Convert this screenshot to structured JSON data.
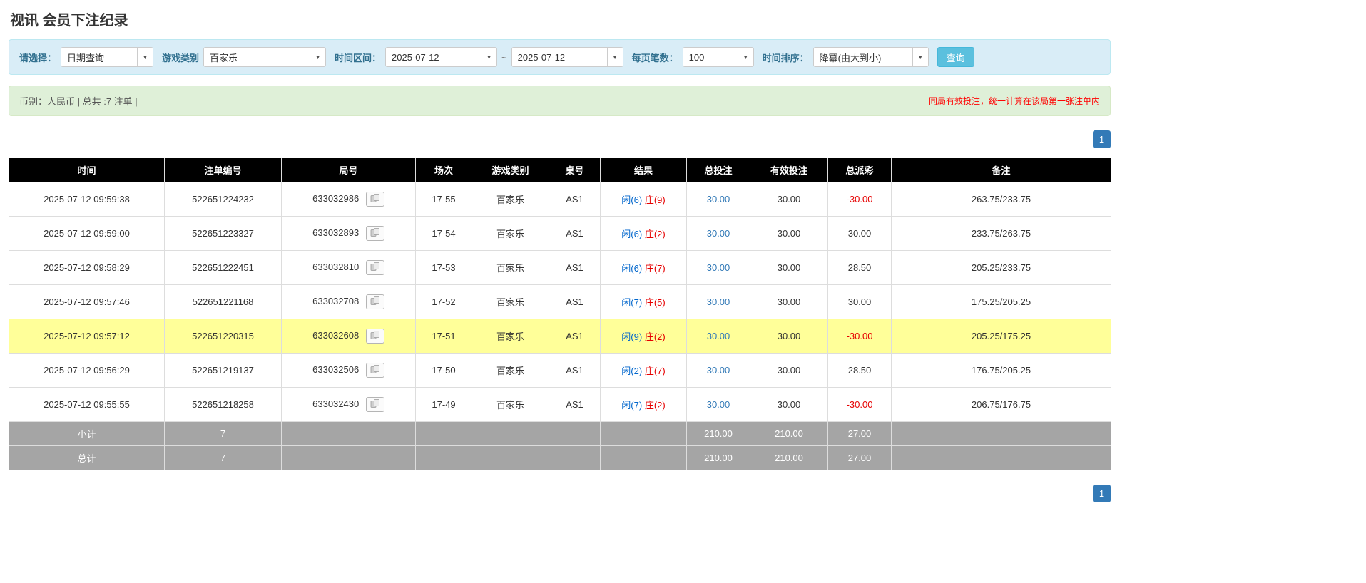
{
  "page": {
    "title": "视讯 会员下注纪录"
  },
  "filters": {
    "query_type": {
      "label": "请选择：",
      "value": "日期查询"
    },
    "game_type": {
      "label": "游戏类别",
      "value": "百家乐"
    },
    "date_range": {
      "label": "时间区间：",
      "from": "2025-07-12",
      "separator": "~",
      "to": "2025-07-12"
    },
    "page_size": {
      "label": "每页笔数：",
      "value": "100"
    },
    "sort": {
      "label": "时间排序：",
      "value": "降冪(由大到小)"
    },
    "search_button_label": "查询"
  },
  "summary": {
    "left": "币别：人民币 | 总共 :7 注单 |",
    "right": "同局有效投注，统一计算在该局第一张注单内"
  },
  "pagination": {
    "page": "1"
  },
  "icons": {
    "round_detail_icon": "cards-icon",
    "dropdown_arrow_icon": "chevron-down-icon"
  },
  "colors": {
    "accent_blue": "#337ab7",
    "player_blue": "#0066cc",
    "banker_red": "#e60000",
    "negative_red": "#e60000",
    "header_bg": "#000000",
    "highlight_row": "#ffff99",
    "footer_bg": "#a5a5a5",
    "filter_bar_bg": "#d9edf7",
    "summary_bar_bg": "#dff0d8",
    "search_button_bg": "#5bc0de"
  },
  "table": {
    "headers": [
      "时间",
      "注单编号",
      "局号",
      "场次",
      "游戏类别",
      "桌号",
      "结果",
      "总投注",
      "有效投注",
      "总派彩",
      "备注"
    ],
    "rows": [
      {
        "time": "2025-07-12 09:59:38",
        "bet_id": "522651224232",
        "round_id": "633032986",
        "session": "17-55",
        "game": "百家乐",
        "table_no": "AS1",
        "result_player": "闲(6)",
        "result_banker": "庄(9)",
        "total_bet": "30.00",
        "valid_bet": "30.00",
        "payout": "-30.00",
        "note": "263.75/233.75",
        "highlighted": false
      },
      {
        "time": "2025-07-12 09:59:00",
        "bet_id": "522651223327",
        "round_id": "633032893",
        "session": "17-54",
        "game": "百家乐",
        "table_no": "AS1",
        "result_player": "闲(6)",
        "result_banker": "庄(2)",
        "total_bet": "30.00",
        "valid_bet": "30.00",
        "payout": "30.00",
        "note": "233.75/263.75",
        "highlighted": false
      },
      {
        "time": "2025-07-12 09:58:29",
        "bet_id": "522651222451",
        "round_id": "633032810",
        "session": "17-53",
        "game": "百家乐",
        "table_no": "AS1",
        "result_player": "闲(6)",
        "result_banker": "庄(7)",
        "total_bet": "30.00",
        "valid_bet": "30.00",
        "payout": "28.50",
        "note": "205.25/233.75",
        "highlighted": false
      },
      {
        "time": "2025-07-12 09:57:46",
        "bet_id": "522651221168",
        "round_id": "633032708",
        "session": "17-52",
        "game": "百家乐",
        "table_no": "AS1",
        "result_player": "闲(7)",
        "result_banker": "庄(5)",
        "total_bet": "30.00",
        "valid_bet": "30.00",
        "payout": "30.00",
        "note": "175.25/205.25",
        "highlighted": false
      },
      {
        "time": "2025-07-12 09:57:12",
        "bet_id": "522651220315",
        "round_id": "633032608",
        "session": "17-51",
        "game": "百家乐",
        "table_no": "AS1",
        "result_player": "闲(9)",
        "result_banker": "庄(2)",
        "total_bet": "30.00",
        "valid_bet": "30.00",
        "payout": "-30.00",
        "note": "205.25/175.25",
        "highlighted": true
      },
      {
        "time": "2025-07-12 09:56:29",
        "bet_id": "522651219137",
        "round_id": "633032506",
        "session": "17-50",
        "game": "百家乐",
        "table_no": "AS1",
        "result_player": "闲(2)",
        "result_banker": "庄(7)",
        "total_bet": "30.00",
        "valid_bet": "30.00",
        "payout": "28.50",
        "note": "176.75/205.25",
        "highlighted": false
      },
      {
        "time": "2025-07-12 09:55:55",
        "bet_id": "522651218258",
        "round_id": "633032430",
        "session": "17-49",
        "game": "百家乐",
        "table_no": "AS1",
        "result_player": "闲(7)",
        "result_banker": "庄(2)",
        "total_bet": "30.00",
        "valid_bet": "30.00",
        "payout": "-30.00",
        "note": "206.75/176.75",
        "highlighted": false
      }
    ],
    "subtotal": {
      "label": "小计",
      "count": "7",
      "total_bet": "210.00",
      "valid_bet": "210.00",
      "payout": "27.00"
    },
    "total": {
      "label": "总计",
      "count": "7",
      "total_bet": "210.00",
      "valid_bet": "210.00",
      "payout": "27.00"
    }
  }
}
